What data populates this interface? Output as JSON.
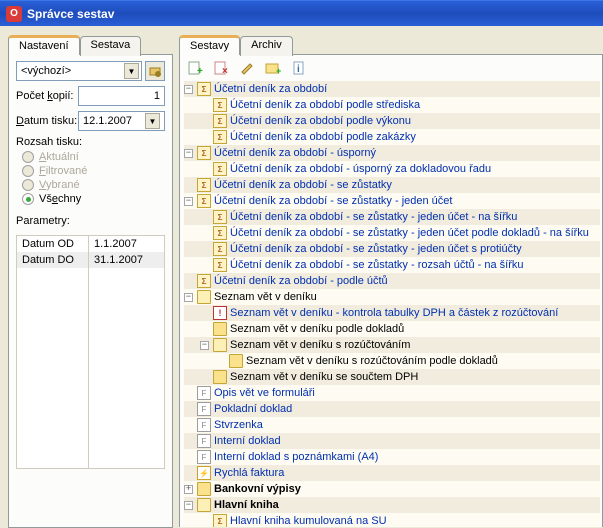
{
  "window": {
    "title": "Správce sestav"
  },
  "left": {
    "tabs": {
      "settings": "Nastavení",
      "report": "Sestava"
    },
    "preset": {
      "value": "<výchozí>"
    },
    "copies": {
      "label_pre": "Počet ",
      "label_u": "k",
      "label_post": "opií:",
      "value": "1"
    },
    "print_date": {
      "label_u": "D",
      "label_post": "atum tisku:",
      "value": "12.1.2007"
    },
    "range": {
      "label": "Rozsah tisku:",
      "opts": {
        "current": "Aktuální",
        "filtered": "Filtrované",
        "selected": "Vybrané",
        "all": "Všechny"
      }
    },
    "params": {
      "label": "Parametry:",
      "rows": [
        {
          "name": "Datum OD",
          "value": "1.1.2007"
        },
        {
          "name": "Datum DO",
          "value": "31.1.2007"
        }
      ]
    }
  },
  "right": {
    "tabs": {
      "reports": "Sestavy",
      "archive": "Archiv"
    },
    "tree": [
      {
        "d": 0,
        "t": "-",
        "i": "report",
        "c": "link",
        "s": 0,
        "text": "Účetní deník za období"
      },
      {
        "d": 1,
        "t": "",
        "i": "report",
        "c": "link",
        "s": 1,
        "text": "Účetní deník za období podle střediska"
      },
      {
        "d": 1,
        "t": "",
        "i": "report",
        "c": "link",
        "s": 0,
        "text": "Účetní deník za období podle výkonu"
      },
      {
        "d": 1,
        "t": "",
        "i": "report",
        "c": "link",
        "s": 1,
        "text": "Účetní deník za období podle zakázky"
      },
      {
        "d": 0,
        "t": "-",
        "i": "report",
        "c": "link",
        "s": 0,
        "text": "Účetní deník za období - úsporný"
      },
      {
        "d": 1,
        "t": "",
        "i": "report",
        "c": "link",
        "s": 1,
        "text": "Účetní deník za období - úsporný za dokladovou řadu"
      },
      {
        "d": 0,
        "t": "",
        "i": "report",
        "c": "link",
        "s": 0,
        "text": "Účetní deník za období - se zůstatky"
      },
      {
        "d": 0,
        "t": "-",
        "i": "report",
        "c": "link",
        "s": 1,
        "text": "Účetní deník za období - se zůstatky - jeden účet"
      },
      {
        "d": 1,
        "t": "",
        "i": "report",
        "c": "link",
        "s": 0,
        "text": "Účetní deník za období - se zůstatky - jeden účet - na šířku"
      },
      {
        "d": 1,
        "t": "",
        "i": "report",
        "c": "link",
        "s": 1,
        "text": "Účetní deník za období - se zůstatky - jeden účet podle dokladů - na šířku"
      },
      {
        "d": 1,
        "t": "",
        "i": "report",
        "c": "link",
        "s": 0,
        "text": "Účetní deník za období - se zůstatky - jeden účet s protiúčty"
      },
      {
        "d": 1,
        "t": "",
        "i": "report",
        "c": "link",
        "s": 1,
        "text": "Účetní deník za období - se zůstatky - rozsah účtů - na šířku"
      },
      {
        "d": 0,
        "t": "",
        "i": "report",
        "c": "link",
        "s": 0,
        "text": "Účetní deník za období - podle účtů"
      },
      {
        "d": 0,
        "t": "-",
        "i": "folderopen",
        "c": "plain",
        "s": 1,
        "text": "Seznam vět v deníku"
      },
      {
        "d": 1,
        "t": "",
        "i": "warn",
        "c": "link",
        "s": 0,
        "text": "Seznam vět v deníku - kontrola tabulky DPH a částek z rozúčtování"
      },
      {
        "d": 1,
        "t": "",
        "i": "folder",
        "c": "plain",
        "s": 1,
        "text": "Seznam vět v deníku podle dokladů"
      },
      {
        "d": 1,
        "t": "-",
        "i": "folderopen",
        "c": "plain",
        "s": 0,
        "text": "Seznam vět v deníku s rozúčtováním"
      },
      {
        "d": 2,
        "t": "",
        "i": "folder",
        "c": "plain",
        "s": 1,
        "text": "Seznam vět v deníku s rozúčtováním podle dokladů"
      },
      {
        "d": 1,
        "t": "",
        "i": "folder",
        "c": "plain",
        "s": 0,
        "text": "Seznam vět v deníku se součtem DPH"
      },
      {
        "d": 0,
        "t": "",
        "i": "formrep",
        "c": "link",
        "s": 1,
        "text": "Opis vět ve formuláři"
      },
      {
        "d": 0,
        "t": "",
        "i": "formrep",
        "c": "link",
        "s": 0,
        "text": "Pokladní doklad"
      },
      {
        "d": 0,
        "t": "",
        "i": "formrep",
        "c": "link",
        "s": 1,
        "text": "Stvrzenka"
      },
      {
        "d": 0,
        "t": "",
        "i": "formrep",
        "c": "link",
        "s": 0,
        "text": "Interní doklad"
      },
      {
        "d": 0,
        "t": "",
        "i": "formrep",
        "c": "link",
        "s": 1,
        "text": "Interní doklad s poznámkami (A4)"
      },
      {
        "d": 0,
        "t": "",
        "i": "quick",
        "c": "link",
        "s": 0,
        "text": "Rychlá faktura"
      },
      {
        "d": 0,
        "t": "+",
        "i": "folder",
        "c": "bold",
        "s": 1,
        "text": "Bankovní výpisy"
      },
      {
        "d": 0,
        "t": "-",
        "i": "folderopen",
        "c": "bold",
        "s": 0,
        "text": "Hlavní kniha"
      },
      {
        "d": 1,
        "t": "",
        "i": "report",
        "c": "link",
        "s": 1,
        "text": "Hlavní kniha kumulovaná na SU"
      }
    ]
  }
}
